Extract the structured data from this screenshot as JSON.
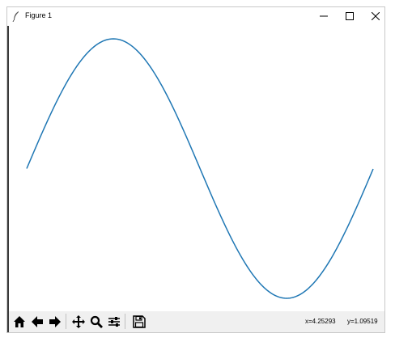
{
  "window": {
    "title": "Figure 1",
    "icon": "feather-icon",
    "controls": [
      "minimize-icon",
      "maximize-icon",
      "close-icon"
    ]
  },
  "chart_data": {
    "type": "line",
    "function": "sin",
    "x_range": [
      0,
      6.28
    ],
    "y_range": [
      -1,
      1
    ],
    "series": [
      {
        "color": "#1f77b4",
        "x": [
          0,
          0.25,
          0.5,
          0.75,
          1.0,
          1.25,
          1.5,
          1.57,
          1.75,
          2.0,
          2.25,
          2.5,
          2.75,
          3.0,
          3.14,
          3.25,
          3.5,
          3.75,
          4.0,
          4.25,
          4.5,
          4.71,
          4.75,
          5.0,
          5.25,
          5.5,
          5.75,
          6.0,
          6.28
        ],
        "y": [
          0,
          0.247,
          0.479,
          0.682,
          0.841,
          0.949,
          0.997,
          1.0,
          0.984,
          0.909,
          0.778,
          0.598,
          0.382,
          0.141,
          0.0,
          -0.108,
          -0.351,
          -0.572,
          -0.757,
          -0.895,
          -0.978,
          -1.0,
          -0.999,
          -0.959,
          -0.859,
          -0.706,
          -0.508,
          -0.279,
          0.0
        ]
      }
    ],
    "grid": false,
    "axes_visible": false
  },
  "toolbar": {
    "buttons": [
      {
        "name": "home-icon"
      },
      {
        "name": "back-icon"
      },
      {
        "name": "forward-icon"
      },
      {
        "name": "pan-icon"
      },
      {
        "name": "zoom-icon"
      },
      {
        "name": "configure-subplots-icon"
      },
      {
        "name": "save-icon"
      }
    ],
    "x_readout": "x=4.25293",
    "y_readout": "y=1.09519"
  }
}
